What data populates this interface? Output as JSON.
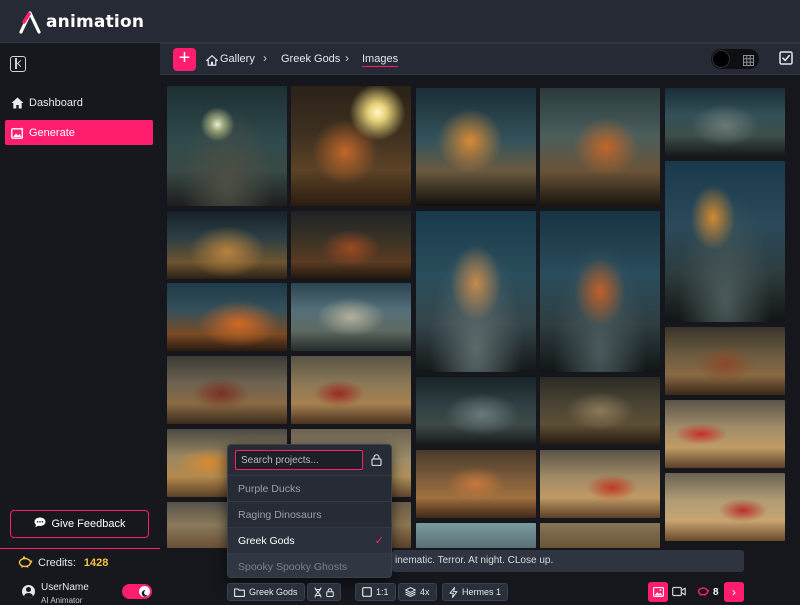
{
  "app": {
    "logo_text": "animation"
  },
  "sidebar": {
    "items": [
      {
        "label": "Dashboard",
        "icon": "home-icon",
        "active": false
      },
      {
        "label": "Generate",
        "icon": "image-sparkle-icon",
        "active": true
      }
    ],
    "feedback_label": "Give Feedback",
    "credits_label": "Credits:",
    "credits_value": "1428",
    "user_name": "UserName",
    "user_role": "AI Animator"
  },
  "breadcrumb": {
    "items": [
      {
        "label": "Gallery",
        "icon": "home-icon"
      },
      {
        "label": "Greek Gods"
      },
      {
        "label": "Images",
        "current": true
      }
    ]
  },
  "project_dropdown": {
    "search_placeholder": "Search projects...",
    "options": [
      {
        "label": "Purple Ducks",
        "selected": false
      },
      {
        "label": "Raging Dinosaurs",
        "selected": false
      },
      {
        "label": "Greek Gods",
        "selected": true
      },
      {
        "label": "Spooky Spooky Ghosts",
        "selected": false
      }
    ]
  },
  "prompt": {
    "value": "inematic. Terror. At night. CLose up."
  },
  "toolbar": {
    "project": "Greek Gods",
    "aspect": "1:1",
    "upscale": "4x",
    "model": "Hermes 1",
    "cost": "8"
  },
  "colors": {
    "accent": "#ff1e6e",
    "credits": "#f5c242",
    "panel": "#252a34",
    "background": "#15171c"
  }
}
